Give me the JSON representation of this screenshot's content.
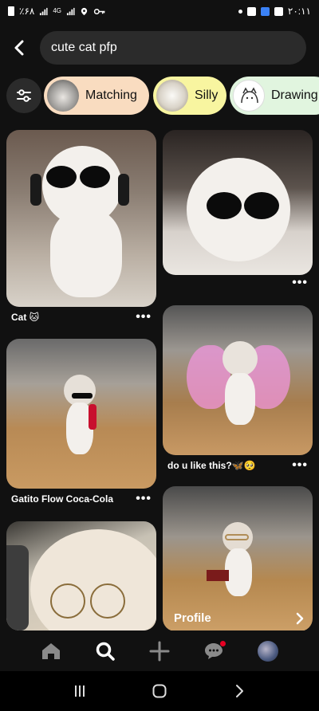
{
  "status_bar": {
    "left_text": "٪۶۸",
    "signal_label": "4G",
    "time": "۲۰:۱۱"
  },
  "search": {
    "query": "cute cat pfp"
  },
  "chips": [
    {
      "label": "Matching",
      "color": "#f9dcc0"
    },
    {
      "label": "Silly",
      "color": "#f8f5a0"
    },
    {
      "label": "Drawing",
      "color": "#e1f5df"
    }
  ],
  "pins": [
    {
      "title": "Cat 🐱",
      "more": "•••"
    },
    {
      "title": "",
      "more": "•••"
    },
    {
      "title": "do u like this?🦋🥺",
      "more": "•••"
    },
    {
      "title": "Gatito Flow Coca-Cola",
      "more": "•••"
    },
    {
      "title": "",
      "more": ""
    },
    {
      "overlay_label": "Profile"
    }
  ],
  "nav": {
    "items": [
      "home-icon",
      "search-icon",
      "add-icon",
      "messages-icon",
      "profile-avatar"
    ],
    "active": "search-icon",
    "notification_color": "#e60023"
  }
}
